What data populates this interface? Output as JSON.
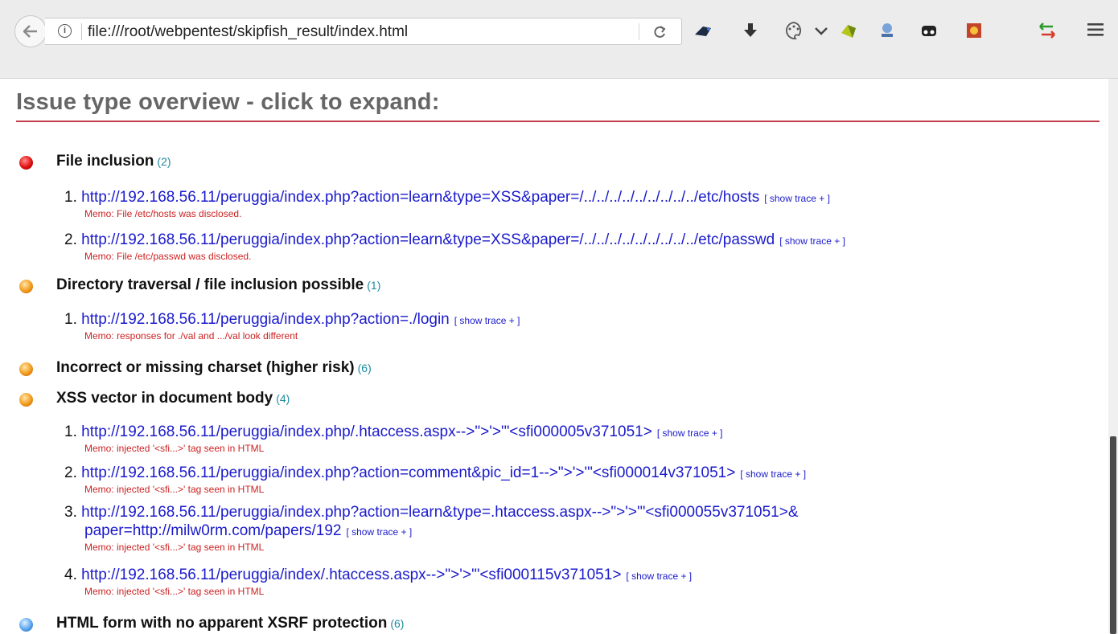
{
  "browser": {
    "url": "file:///root/webpentest/skipfish_result/index.html"
  },
  "page": {
    "heading": "Issue type overview - click to expand:",
    "trace_label": "[ show trace + ]"
  },
  "issues": [
    {
      "title": "File inclusion",
      "count": "(2)",
      "severity": "high",
      "entries": [
        {
          "num": "1.",
          "url": "http://192.168.56.11/peruggia/index.php?action=learn&type=XSS&paper=/../../../../../../../../../etc/hosts",
          "memo": "Memo: File /etc/hosts was disclosed."
        },
        {
          "num": "2.",
          "url": "http://192.168.56.11/peruggia/index.php?action=learn&type=XSS&paper=/../../../../../../../../../etc/passwd",
          "memo": "Memo: File /etc/passwd was disclosed."
        }
      ]
    },
    {
      "title": "Directory traversal / file inclusion possible",
      "count": "(1)",
      "severity": "medium",
      "entries": [
        {
          "num": "1.",
          "url": "http://192.168.56.11/peruggia/index.php?action=./login",
          "memo": "Memo: responses for ./val and .../val look different"
        }
      ]
    },
    {
      "title": "Incorrect or missing charset (higher risk)",
      "count": "(6)",
      "severity": "medium",
      "entries": []
    },
    {
      "title": "XSS vector in document body",
      "count": "(4)",
      "severity": "medium",
      "entries": [
        {
          "num": "1.",
          "url": "http://192.168.56.11/peruggia/index.php/.htaccess.aspx-->\">'>'\"<sfi000005v371051>",
          "memo": "Memo: injected '<sfi...>' tag seen in HTML"
        },
        {
          "num": "2.",
          "url": "http://192.168.56.11/peruggia/index.php?action=comment&pic_id=1-->\">'>'\"<sfi000014v371051>",
          "memo": "Memo: injected '<sfi...>' tag seen in HTML"
        },
        {
          "num": "3.",
          "url": "http://192.168.56.11/peruggia/index.php?action=learn&type=.htaccess.aspx-->\">'>'\"<sfi000055v371051>&",
          "url_cont": "paper=http://milw0rm.com/papers/192",
          "memo": "Memo: injected '<sfi...>' tag seen in HTML"
        },
        {
          "num": "4.",
          "url": "http://192.168.56.11/peruggia/index/.htaccess.aspx-->\">'>'\"<sfi000115v371051>",
          "memo": "Memo: injected '<sfi...>' tag seen in HTML"
        }
      ]
    },
    {
      "title": "HTML form with no apparent XSRF protection",
      "count": "(6)",
      "severity": "low",
      "entries": []
    }
  ],
  "colors": {
    "high": "#e01010",
    "medium": "#f29a1c",
    "low": "#5aa6f0",
    "link": "#1a1acc",
    "memo": "#cc2222",
    "rule": "#c23b4a"
  },
  "icons": [
    "back-arrow-icon",
    "info-icon",
    "reload-icon",
    "bookmark-bird-icon",
    "download-icon",
    "palette-icon",
    "chevron-down-icon",
    "puzzle-icon",
    "user-agent-icon",
    "mask-icon",
    "extension-orange-icon",
    "swap-arrows-icon",
    "hamburger-menu-icon"
  ]
}
